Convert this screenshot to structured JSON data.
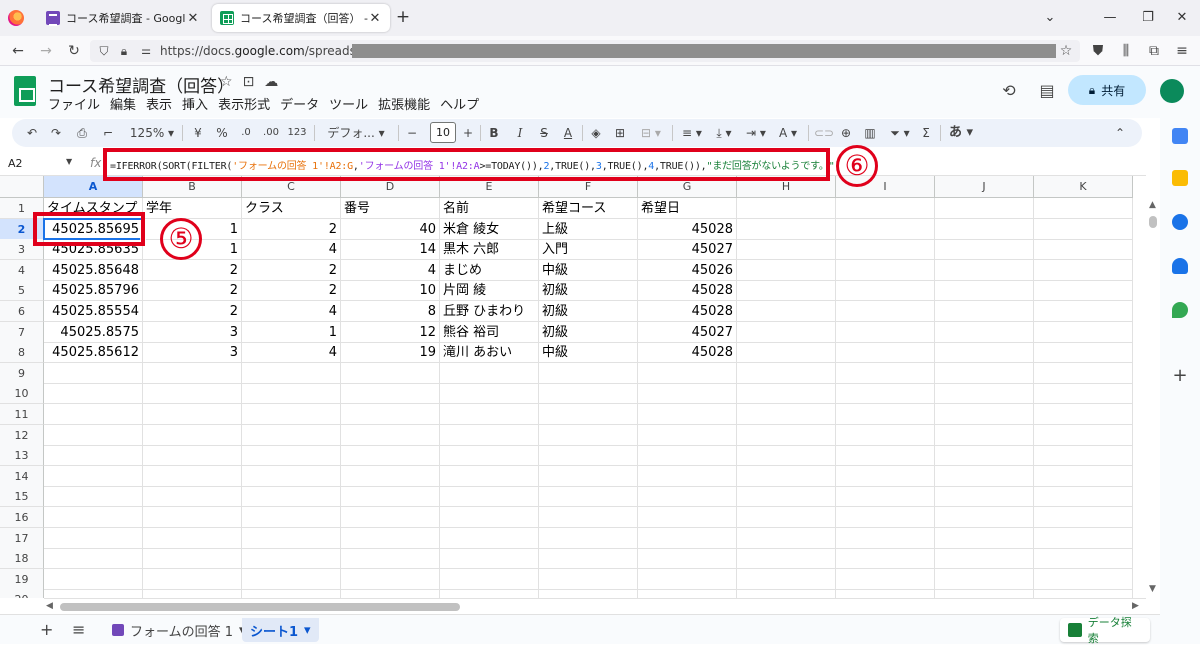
{
  "browser": {
    "tabs": [
      {
        "label": "コース希望調査 - Google フォーム",
        "icon": "forms-icon",
        "active": false
      },
      {
        "label": "コース希望調査（回答） - Googl",
        "icon": "sheets-icon",
        "active": true
      }
    ],
    "url_prefix": "https://docs.",
    "url_domain": "google.com",
    "url_path": "/spreadsheets/"
  },
  "doc": {
    "title": "コース希望調査（回答）",
    "menu": [
      "ファイル",
      "編集",
      "表示",
      "挿入",
      "表示形式",
      "データ",
      "ツール",
      "拡張機能",
      "ヘルプ"
    ],
    "share_label": "共有"
  },
  "toolbar": {
    "zoom": "125%",
    "currency": "¥",
    "percent": "%",
    "dec_decrease": ".0",
    "dec_increase": ".00",
    "number_format": "123",
    "font": "デフォ...",
    "font_size": "10",
    "input_method": "あ"
  },
  "formula_bar": {
    "cell_ref": "A2",
    "fx": "fx",
    "parts": {
      "p1": "=IFERROR(SORT(FILTER(",
      "p2": "'フォームの回答 1'!A2:G",
      "p3": ",",
      "p4": "'フォームの回答 1'!A2:A",
      "p5": ">=TODAY()),",
      "p6": "2",
      "p7": ",TRUE(),",
      "p8": "3",
      "p9": ",TRUE(),",
      "p10": "4",
      "p11": ",TRUE()),",
      "p12": "\"まだ回答がないようです。\"",
      "p13": ")"
    }
  },
  "grid": {
    "columns": [
      "A",
      "B",
      "C",
      "D",
      "E",
      "F",
      "G",
      "H",
      "I",
      "J",
      "K"
    ],
    "rows": [
      "1",
      "2",
      "3",
      "4",
      "5",
      "6",
      "7",
      "8",
      "9",
      "10",
      "11",
      "12",
      "13",
      "14",
      "15",
      "16",
      "17",
      "18",
      "19",
      "20"
    ],
    "header": [
      "タイムスタンプ",
      "学年",
      "クラス",
      "番号",
      "名前",
      "希望コース",
      "希望日"
    ],
    "data": [
      [
        "45025.85695",
        "1",
        "2",
        "40",
        "米倉 綾女",
        "上級",
        "45028"
      ],
      [
        "45025.85635",
        "1",
        "4",
        "14",
        "黒木 六郎",
        "入門",
        "45027"
      ],
      [
        "45025.85648",
        "2",
        "2",
        "4",
        "まじめ",
        "中級",
        "45026"
      ],
      [
        "45025.85796",
        "2",
        "2",
        "10",
        "片岡 綾",
        "初級",
        "45028"
      ],
      [
        "45025.85554",
        "2",
        "4",
        "8",
        "丘野 ひまわり",
        "初級",
        "45028"
      ],
      [
        "45025.8575",
        "3",
        "1",
        "12",
        "熊谷 裕司",
        "初級",
        "45027"
      ],
      [
        "45025.85612",
        "3",
        "4",
        "19",
        "滝川 あおい",
        "中級",
        "45028"
      ]
    ]
  },
  "annotations": {
    "five": "⑤",
    "six": "⑥"
  },
  "sheets": {
    "tabs": [
      "フォームの回答 1",
      "シート1"
    ],
    "active": "シート1",
    "explore_label": "データ探索"
  }
}
